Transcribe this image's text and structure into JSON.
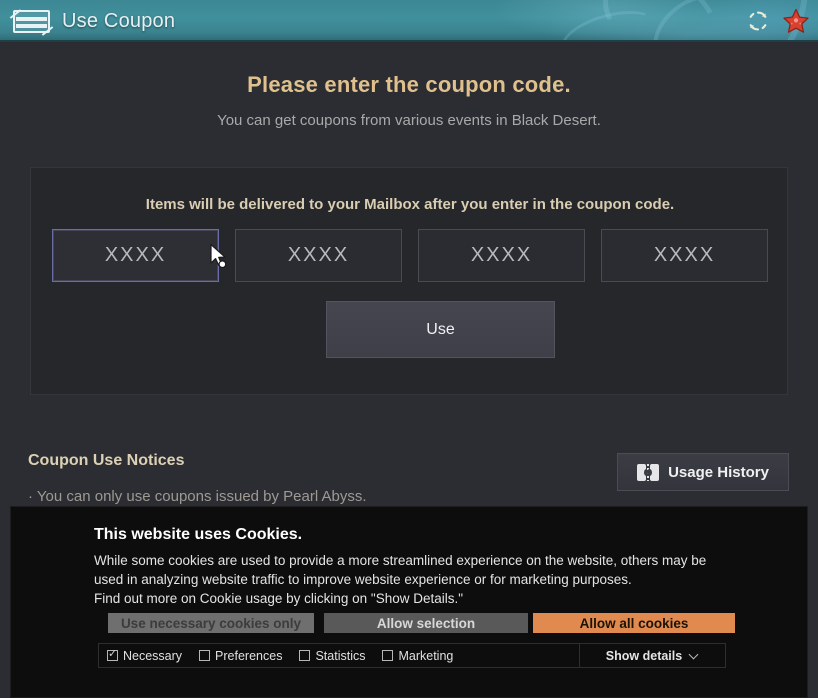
{
  "titlebar": {
    "title": "Use Coupon",
    "coupon_icon": "coupon-icon",
    "refresh_icon": "refresh-icon",
    "close_icon": "starfish-close-icon"
  },
  "main": {
    "headline": "Please enter the coupon code.",
    "subline": "You can get coupons from various events in Black Desert.",
    "card_note": "Items will be delivered to your Mailbox after you enter in the coupon code.",
    "code_fields": [
      {
        "value": "XXXX",
        "focused": true
      },
      {
        "value": "XXXX",
        "focused": false
      },
      {
        "value": "XXXX",
        "focused": false
      },
      {
        "value": "XXXX",
        "focused": false
      }
    ],
    "use_button": "Use",
    "history_button": "Usage History",
    "notices_title": "Coupon Use Notices",
    "notices": [
      "· You can only use coupons issued by Pearl Abyss."
    ]
  },
  "cookie_banner": {
    "title": "This website uses Cookies.",
    "body": "While some cookies are used to provide a more streamlined experience on the website, others may be used in analyzing website traffic to improve website experience or for marketing purposes.\nFind out more on Cookie usage by clicking on \"Show Details.\"",
    "buttons": {
      "necessary_only": "Use necessary cookies only",
      "allow_selection": "Allow selection",
      "allow_all": "Allow all cookies"
    },
    "checkboxes": [
      {
        "label": "Necessary",
        "checked": true
      },
      {
        "label": "Preferences",
        "checked": false
      },
      {
        "label": "Statistics",
        "checked": false
      },
      {
        "label": "Marketing",
        "checked": false
      }
    ],
    "show_details": "Show details"
  },
  "colors": {
    "titlebar_teal": "#40909c",
    "headline_gold": "#e0c18d",
    "accent_orange": "#e08a4f",
    "panel_dark": "#26272b",
    "page_bg": "#2b2d33",
    "focus_border": "#6b6ea6"
  }
}
